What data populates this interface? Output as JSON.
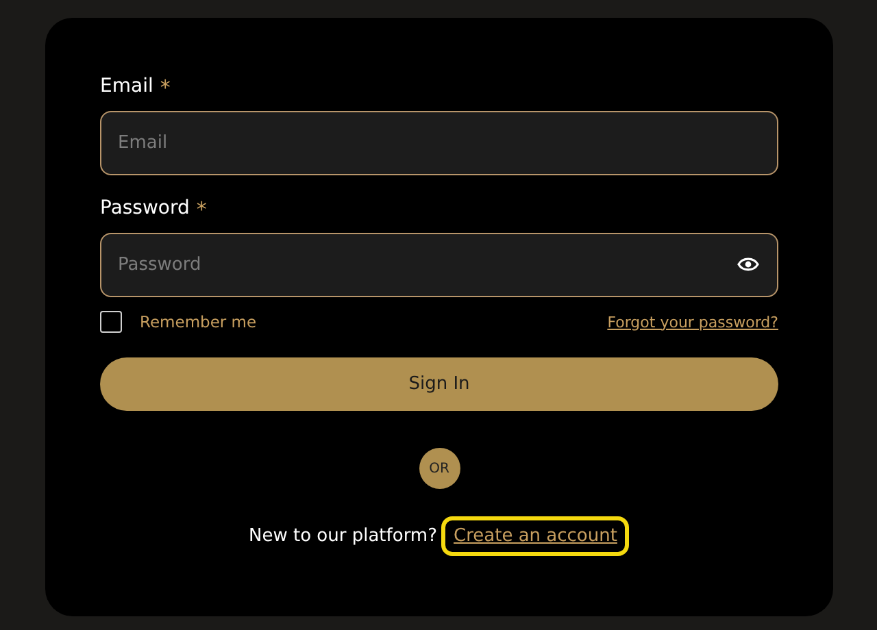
{
  "fields": [
    {
      "kind": "text",
      "label": "Email",
      "required": true,
      "required_mark": "*",
      "placeholder": "Email"
    },
    {
      "kind": "password",
      "label": "Password",
      "required": true,
      "required_mark": "*",
      "placeholder": "Password"
    }
  ],
  "remember": {
    "label": "Remember me",
    "checked": false
  },
  "forgot_link": "Forgot your password?",
  "submit_button": "Sign In",
  "divider": "OR",
  "signup": {
    "prompt": "New to our platform?",
    "link": "Create an account",
    "highlighted": true
  }
}
